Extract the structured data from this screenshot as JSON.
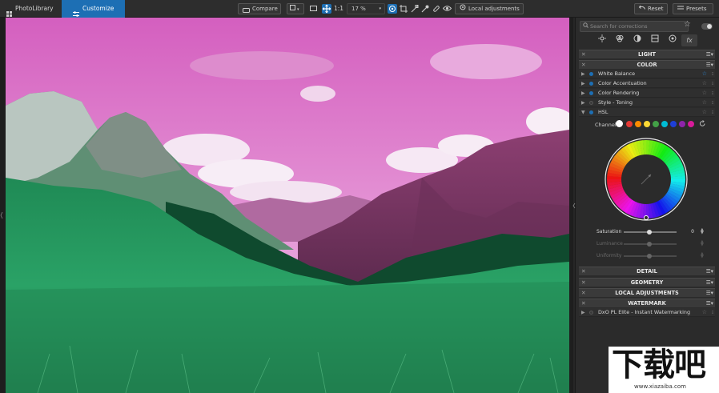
{
  "topbar": {
    "photolibrary_label": "PhotoLibrary",
    "customize_label": "Customize",
    "compare_label": "Compare",
    "zoom_one_label": "1:1",
    "zoom_value": "17 %",
    "local_adjustments_label": "Local adjustments",
    "reset_label": "Reset",
    "presets_label": "Presets"
  },
  "panel": {
    "search_placeholder": "Search for corrections",
    "sections": {
      "light": "LIGHT",
      "color": "COLOR",
      "detail": "DETAIL",
      "geometry": "GEOMETRY",
      "local_adjustments": "LOCAL ADJUSTMENTS",
      "watermark": "WATERMARK"
    },
    "color_items": [
      {
        "label": "White Balance",
        "active": true,
        "starred": true
      },
      {
        "label": "Color Accentuation",
        "active": true,
        "starred": false
      },
      {
        "label": "Color Rendering",
        "active": true,
        "starred": false
      },
      {
        "label": "Style - Toning",
        "active": false,
        "starred": false
      },
      {
        "label": "HSL",
        "active": true,
        "starred": false
      }
    ],
    "hsl": {
      "channel_label": "Channel",
      "channels": [
        "#ffffff",
        "#e53935",
        "#fb8c00",
        "#fdd835",
        "#43a047",
        "#00bcd4",
        "#1e3fd6",
        "#8e24aa",
        "#d81b9a"
      ],
      "saturation_label": "Saturation",
      "saturation_value": "0",
      "luminance_label": "Luminance",
      "uniformity_label": "Uniformity"
    },
    "watermark_item": "DxO PL Elite - Instant Watermarking"
  },
  "logo": {
    "text": "下载吧",
    "url_text": "www.xiazaiba.com"
  }
}
